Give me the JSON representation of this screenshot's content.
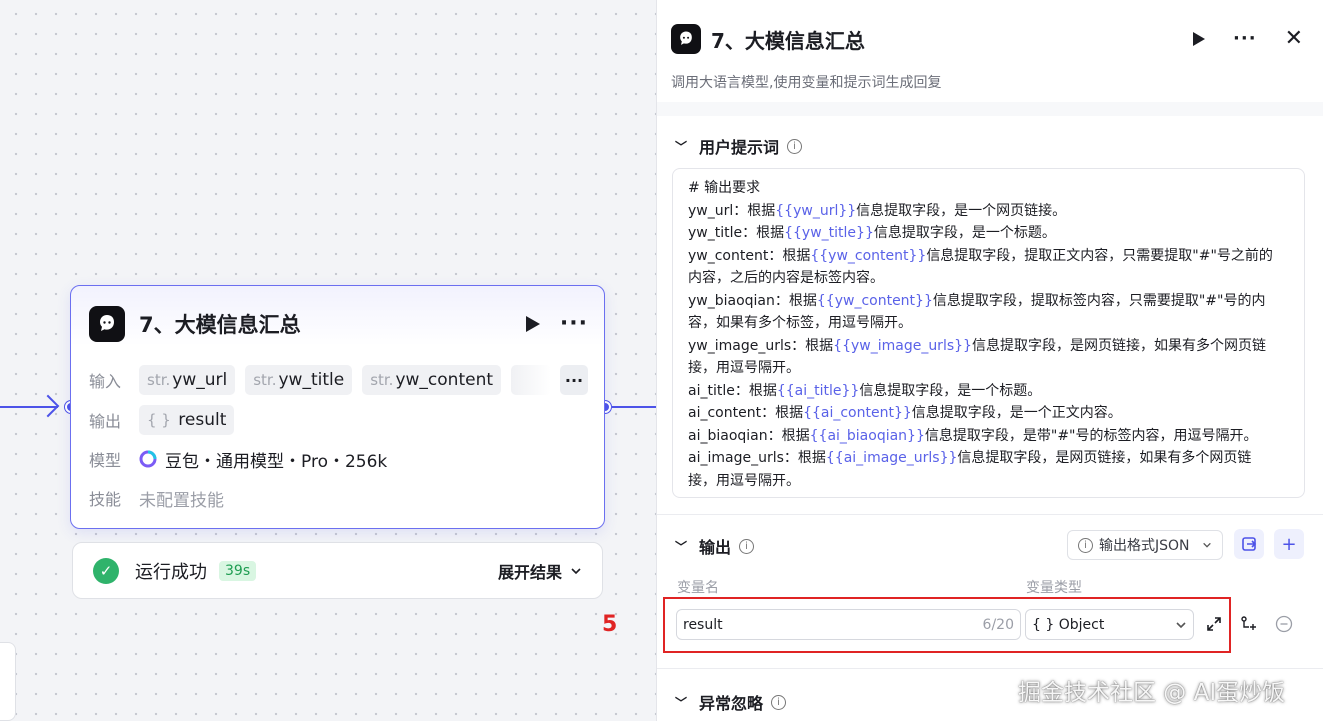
{
  "node": {
    "title": "7、大模信息汇总",
    "input_label": "输入",
    "inputs": [
      {
        "type": "str.",
        "name": "yw_url"
      },
      {
        "type": "str.",
        "name": "yw_title"
      },
      {
        "type": "str.",
        "name": "yw_content"
      }
    ],
    "more_label": "···",
    "output_label": "输出",
    "output_type": "{ }",
    "output_name": "result",
    "model_label": "模型",
    "model_value": "豆包・通用模型・Pro・256k",
    "skill_label": "技能",
    "skill_value": "未配置技能"
  },
  "run_status": {
    "text": "运行成功",
    "duration": "39s",
    "expand_label": "展开结果",
    "check_glyph": "✓",
    "color": "#2fb36b"
  },
  "step_marker": "5",
  "panel": {
    "title": "7、大模信息汇总",
    "description": "调用大语言模型,使用变量和提示词生成回复",
    "close_glyph": "✕",
    "prompt_section": {
      "label": "用户提示词",
      "lines": [
        [
          {
            "t": "# 输出要求"
          }
        ],
        [
          {
            "t": "yw_url：根据"
          },
          {
            "v": "{{yw_url}}"
          },
          {
            "t": "信息提取字段，是一个网页链接。"
          }
        ],
        [
          {
            "t": "yw_title：根据"
          },
          {
            "v": "{{yw_title}}"
          },
          {
            "t": "信息提取字段，是一个标题。"
          }
        ],
        [
          {
            "t": "yw_content：根据"
          },
          {
            "v": "{{yw_content}}"
          },
          {
            "t": "信息提取字段，提取正文内容，只需要提取\"#\"号之前的"
          }
        ],
        [
          {
            "t": "内容，之后的内容是标签内容。"
          }
        ],
        [
          {
            "t": "yw_biaoqian：根据"
          },
          {
            "v": "{{yw_content}}"
          },
          {
            "t": "信息提取字段，提取标签内容，只需要提取\"#\"号的内"
          }
        ],
        [
          {
            "t": "容，如果有多个标签，用逗号隔开。"
          }
        ],
        [
          {
            "t": "yw_image_urls：根据"
          },
          {
            "v": "{{yw_image_urls}}"
          },
          {
            "t": "信息提取字段，是网页链接，如果有多个网页链"
          }
        ],
        [
          {
            "t": "接，用逗号隔开。"
          }
        ],
        [
          {
            "t": "ai_title：根据"
          },
          {
            "v": "{{ai_title}}"
          },
          {
            "t": "信息提取字段，是一个标题。"
          }
        ],
        [
          {
            "t": "ai_content：根据"
          },
          {
            "v": "{{ai_content}}"
          },
          {
            "t": "信息提取字段，是一个正文内容。"
          }
        ],
        [
          {
            "t": "ai_biaoqian：根据"
          },
          {
            "v": "{{ai_biaoqian}}"
          },
          {
            "t": "信息提取字段，是带\"#\"号的标签内容，用逗号隔开。"
          }
        ],
        [
          {
            "t": "ai_image_urls：根据"
          },
          {
            "v": "{{ai_image_urls}}"
          },
          {
            "t": "信息提取字段，是网页链接，如果有多个网页链"
          }
        ],
        [
          {
            "t": "接，用逗号隔开。"
          }
        ]
      ]
    },
    "output_section": {
      "label": "输出",
      "format_label": "输出格式JSON",
      "col_name": "变量名",
      "col_type": "变量类型",
      "var_name": "result",
      "char_count": "6/20",
      "var_type": "{ } Object"
    },
    "exception_section": {
      "label": "异常忽略"
    }
  },
  "watermark": "掘金技术社区 @ AI蛋炒饭",
  "colors": {
    "accent": "#4d53e8",
    "success": "#2fb36b",
    "highlight_box": "#e02424"
  }
}
